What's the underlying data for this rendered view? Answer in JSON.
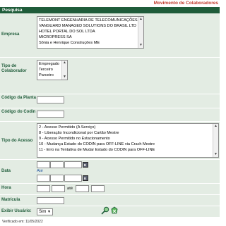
{
  "header": {
    "title": "Movimento de Colaboradores"
  },
  "section": {
    "title": "Pesquisa"
  },
  "empresa": {
    "label": "Empresa",
    "options": [
      "TELEMONT ENGENHARIA DE TELECOMUNICAÇÕES",
      "VANGUARD MANAGED SOLUTIONS DO BRASIL LTD",
      "HOTEL PORTAL DO SOL LTDA",
      "MICROPRESS SA",
      "Sônia e Henrique Construções ME"
    ]
  },
  "tipo_colaborador": {
    "label": "Tipo de Colaborador",
    "options": [
      "Empregado",
      "Terceiro",
      "Parceiro"
    ]
  },
  "codigo_planta": {
    "label": "Código da Planta",
    "value": ""
  },
  "codigo_codin": {
    "label": "Código do Codin",
    "value": ""
  },
  "tipo_acesso": {
    "label": "Tipo do Acesso",
    "options": [
      "2 - Acesso Permitido (A Serviço)",
      "8 - Liberação Incondicional por Cartão Mestre",
      "9 - Acesso Permitido no Estacionamento",
      "10 - Mudança Estado do CODIN para OFF-LINE via Crach  Mestre",
      "11 - Erro na Tentativa de Mudar Estado do CODIN para OFF-LINE"
    ]
  },
  "data": {
    "label": "Data",
    "ate_label": "Até"
  },
  "hora": {
    "label": "Hora",
    "ate_label": "até"
  },
  "matricula": {
    "label": "Matrícula",
    "value": ""
  },
  "exibir_usuario": {
    "label": "Exibir Usuário:",
    "selected": "Sim"
  },
  "footer": {
    "text": "Verificado em: 11/05/2022"
  },
  "colors": {
    "bar": "#1f5c3a",
    "row": "#e3ece3",
    "title": "#c0392b"
  }
}
